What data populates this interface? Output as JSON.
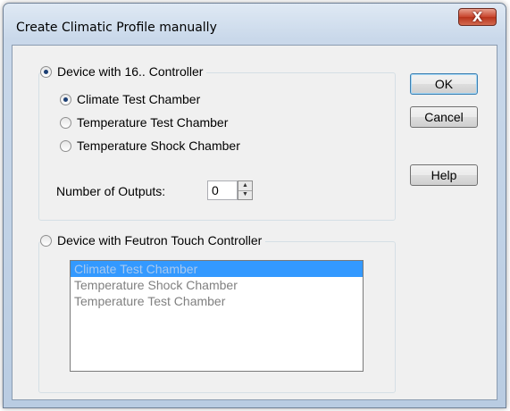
{
  "window": {
    "title": "Create Climatic Profile manually",
    "close_glyph": "X"
  },
  "group1": {
    "label": "Device with 16.. Controller",
    "selected": true,
    "options": [
      {
        "label": "Climate Test Chamber",
        "checked": true
      },
      {
        "label": "Temperature Test Chamber",
        "checked": false
      },
      {
        "label": "Temperature Shock Chamber",
        "checked": false
      }
    ],
    "outputs_label": "Number of Outputs:",
    "outputs_value": "0"
  },
  "group2": {
    "label": "Device with Feutron Touch Controller",
    "selected": false,
    "list_items": [
      {
        "label": "Climate Test Chamber",
        "selected": true
      },
      {
        "label": "Temperature Shock Chamber",
        "selected": false
      },
      {
        "label": "Temperature Test Chamber",
        "selected": false
      }
    ]
  },
  "buttons": {
    "ok": "OK",
    "cancel": "Cancel",
    "help": "Help"
  }
}
